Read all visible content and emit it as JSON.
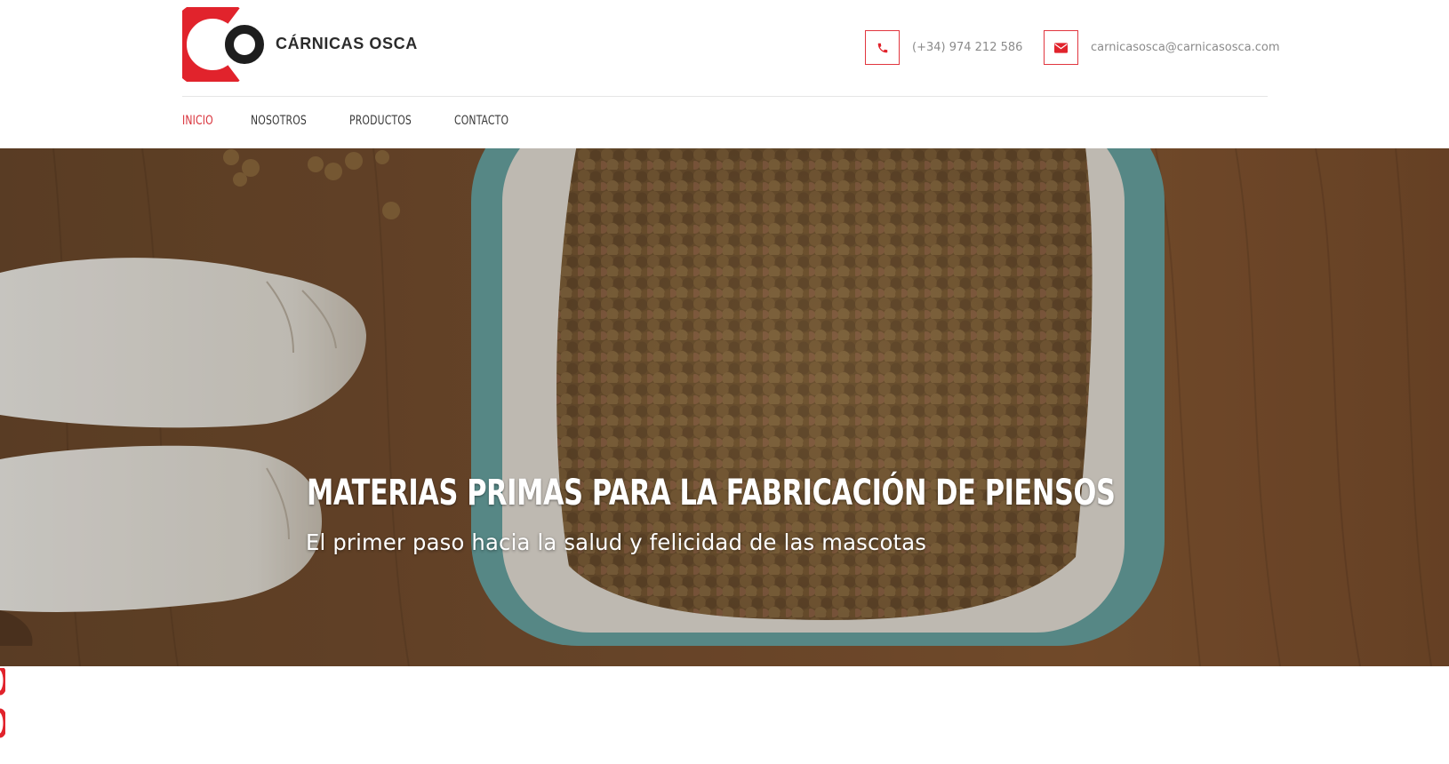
{
  "brand": {
    "name": "CÁRNICAS OSCA",
    "logo_letters": "CO",
    "accent": "#e1232c"
  },
  "contact": {
    "phone": {
      "icon": "phone-icon",
      "text": "(+34) 974 212 586"
    },
    "email": {
      "icon": "envelope-icon",
      "text": "carnicasosca@carnicasosca.com"
    }
  },
  "nav": {
    "items": [
      {
        "label": "INICIO",
        "active": true
      },
      {
        "label": "NOSOTROS",
        "active": false
      },
      {
        "label": "PRODUCTOS",
        "active": false
      },
      {
        "label": "CONTACTO",
        "active": false
      }
    ]
  },
  "hero": {
    "title": "MATERIAS PRIMAS PARA LA FABRICACIÓN DE PIENSOS",
    "subtitle": "El primer paso hacia la salud y felicidad de las mascotas"
  }
}
